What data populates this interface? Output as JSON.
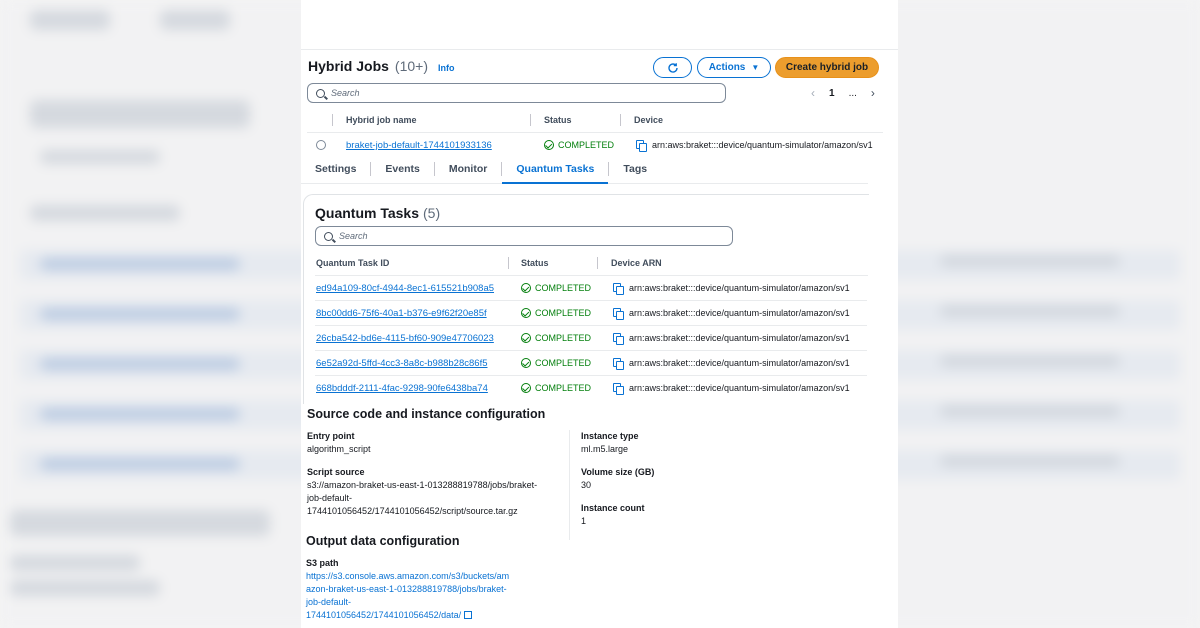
{
  "hybrid_jobs": {
    "title": "Hybrid Jobs",
    "count": "(10+)",
    "info": "Info",
    "actions_label": "Actions",
    "create_label": "Create hybrid job",
    "search_placeholder": "Search",
    "pager": {
      "page": "1",
      "ellipsis": "..."
    },
    "columns": [
      "Hybrid job name",
      "Status",
      "Device"
    ],
    "row": {
      "name": "braket-job-default-1744101933136",
      "status": "COMPLETED",
      "device": "arn:aws:braket:::device/quantum-simulator/amazon/sv1"
    }
  },
  "tabs": [
    {
      "label": "Settings"
    },
    {
      "label": "Events"
    },
    {
      "label": "Monitor"
    },
    {
      "label": "Quantum Tasks"
    },
    {
      "label": "Tags"
    }
  ],
  "quantum_tasks": {
    "title": "Quantum Tasks",
    "count": "(5)",
    "search_placeholder": "Search",
    "columns": [
      "Quantum Task ID",
      "Status",
      "Device ARN"
    ],
    "rows": [
      {
        "id": "ed94a109-80cf-4944-8ec1-615521b908a5",
        "status": "COMPLETED",
        "device": "arn:aws:braket:::device/quantum-simulator/amazon/sv1"
      },
      {
        "id": "8bc00dd6-75f6-40a1-b376-e9f62f20e85f",
        "status": "COMPLETED",
        "device": "arn:aws:braket:::device/quantum-simulator/amazon/sv1"
      },
      {
        "id": "26cba542-bd6e-4115-bf60-909e47706023",
        "status": "COMPLETED",
        "device": "arn:aws:braket:::device/quantum-simulator/amazon/sv1"
      },
      {
        "id": "6e52a92d-5ffd-4cc3-8a8c-b988b28c86f5",
        "status": "COMPLETED",
        "device": "arn:aws:braket:::device/quantum-simulator/amazon/sv1"
      },
      {
        "id": "668bdddf-2111-4fac-9298-90fe6438ba74",
        "status": "COMPLETED",
        "device": "arn:aws:braket:::device/quantum-simulator/amazon/sv1"
      }
    ]
  },
  "source_config": {
    "title": "Source code and instance configuration",
    "entry_point_label": "Entry point",
    "entry_point": "algorithm_script",
    "script_source_label": "Script source",
    "script_source_lines": [
      "s3://amazon-braket-us-east-1-013288819788/jobs/braket-",
      "job-default-",
      "1744101056452/1744101056452/script/source.tar.gz"
    ],
    "instance_type_label": "Instance type",
    "instance_type": "ml.m5.large",
    "volume_size_label": "Volume size (GB)",
    "volume_size": "30",
    "instance_count_label": "Instance count",
    "instance_count": "1"
  },
  "output_config": {
    "title": "Output data configuration",
    "s3_path_label": "S3 path",
    "s3_path_lines": [
      "https://s3.console.aws.amazon.com/s3/buckets/am",
      "azon-braket-us-east-1-013288819788/jobs/braket-",
      "job-default-",
      "1744101056452/1744101056452/data/"
    ]
  },
  "colors": {
    "link": "#0972d3",
    "success": "#037f0c",
    "primary_button": "#ec9d2d"
  }
}
